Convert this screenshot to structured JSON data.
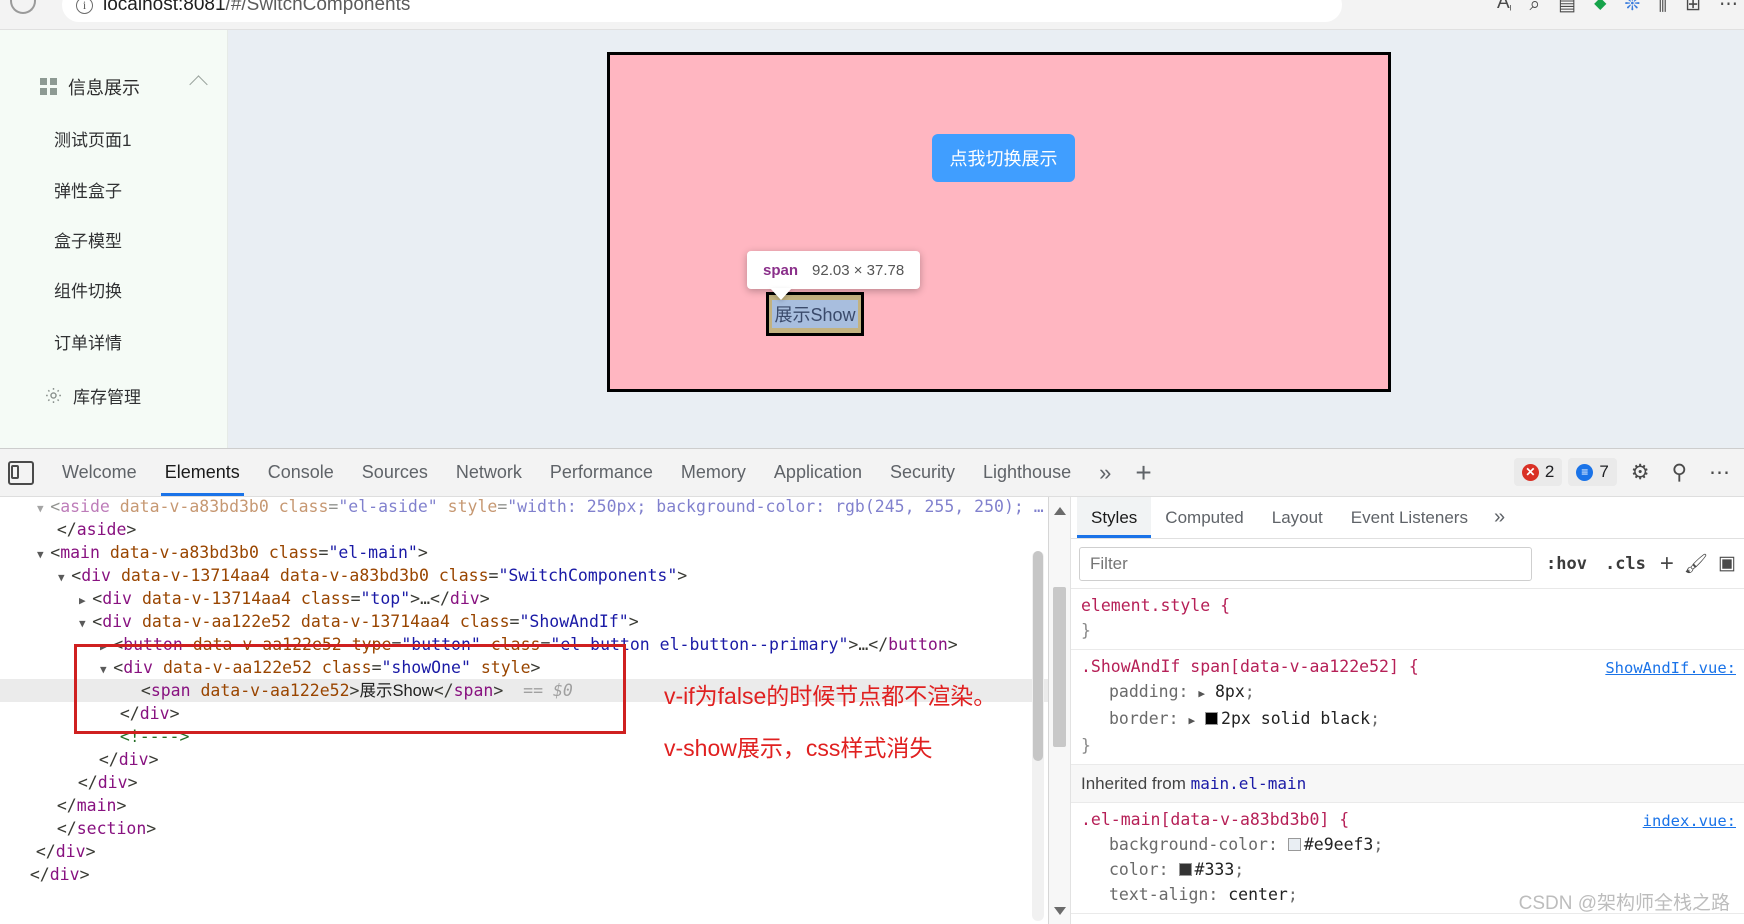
{
  "browser": {
    "url_prefix": "localhost:8081",
    "url_path": "/#/SwitchComponents",
    "reload_icon": "reload-icon",
    "info_icon": "info-circle-icon",
    "right_icons": [
      "read-aloud-icon",
      "zoom-icon",
      "collections-icon",
      "shield-icon",
      "extensions-icon",
      "split-screen-icon",
      "browser-essentials-icon",
      "more-icon"
    ]
  },
  "sidebar": {
    "header": {
      "label": "信息展示",
      "icon": "grid-icon",
      "chevron": "chevron-up-icon"
    },
    "items": [
      {
        "label": "测试页面1",
        "icon": null
      },
      {
        "label": "弹性盒子",
        "icon": null
      },
      {
        "label": "盒子模型",
        "icon": null
      },
      {
        "label": "组件切换",
        "icon": null
      },
      {
        "label": "订单详情",
        "icon": null
      },
      {
        "label": "库存管理",
        "icon": "gear-icon"
      }
    ]
  },
  "page": {
    "toggle_button_label": "点我切换展示",
    "span_text": "展示Show",
    "pink_box_color": "#ffb6c1",
    "button_color": "#409eff",
    "tooltip": {
      "tag": "span",
      "dimensions": "92.03 × 37.78"
    }
  },
  "devtools": {
    "tabs": [
      "Welcome",
      "Elements",
      "Console",
      "Sources",
      "Network",
      "Performance",
      "Memory",
      "Application",
      "Security",
      "Lighthouse"
    ],
    "active_tab": "Elements",
    "more_tabs_icon": "chevron-double-right-icon",
    "add_tab_icon": "plus-icon",
    "error_count": "2",
    "message_count": "7",
    "settings_icon": "gear-icon",
    "devices_icon": "devices-icon",
    "more_icon": "ellipsis-icon",
    "dock_icon": "dock-side-icon"
  },
  "dom_tree": [
    {
      "indent": 1,
      "triangle": "down",
      "selected": false,
      "faded": true,
      "parts": [
        {
          "t": "punct",
          "v": "<"
        },
        {
          "t": "tag",
          "v": "aside"
        },
        {
          "t": "punct",
          "v": " "
        },
        {
          "t": "attr",
          "v": "data-v-a83bd3b0"
        },
        {
          "t": "punct",
          "v": " "
        },
        {
          "t": "attr",
          "v": "class"
        },
        {
          "t": "punct",
          "v": "="
        },
        {
          "t": "val",
          "v": "\"el-aside\""
        },
        {
          "t": "punct",
          "v": " "
        },
        {
          "t": "attr",
          "v": "style"
        },
        {
          "t": "punct",
          "v": "="
        },
        {
          "t": "val",
          "v": "\"width: 250px; background-color: rgb(245, 255, 250); …"
        }
      ]
    },
    {
      "indent": 1,
      "triangle": "none",
      "selected": false,
      "parts": [
        {
          "t": "punct",
          "v": "</"
        },
        {
          "t": "tag",
          "v": "aside"
        },
        {
          "t": "punct",
          "v": ">"
        }
      ]
    },
    {
      "indent": 1,
      "triangle": "down",
      "selected": false,
      "parts": [
        {
          "t": "punct",
          "v": "<"
        },
        {
          "t": "tag",
          "v": "main"
        },
        {
          "t": "punct",
          "v": " "
        },
        {
          "t": "attr",
          "v": "data-v-a83bd3b0"
        },
        {
          "t": "punct",
          "v": " "
        },
        {
          "t": "attr",
          "v": "class"
        },
        {
          "t": "punct",
          "v": "="
        },
        {
          "t": "val",
          "v": "\"el-main\""
        },
        {
          "t": "punct",
          "v": ">"
        }
      ]
    },
    {
      "indent": 2,
      "triangle": "down",
      "selected": false,
      "parts": [
        {
          "t": "punct",
          "v": "<"
        },
        {
          "t": "tag",
          "v": "div"
        },
        {
          "t": "punct",
          "v": " "
        },
        {
          "t": "attr",
          "v": "data-v-13714aa4"
        },
        {
          "t": "punct",
          "v": " "
        },
        {
          "t": "attr",
          "v": "data-v-a83bd3b0"
        },
        {
          "t": "punct",
          "v": " "
        },
        {
          "t": "attr",
          "v": "class"
        },
        {
          "t": "punct",
          "v": "="
        },
        {
          "t": "val",
          "v": "\"SwitchComponents\""
        },
        {
          "t": "punct",
          "v": ">"
        }
      ]
    },
    {
      "indent": 3,
      "triangle": "right",
      "selected": false,
      "parts": [
        {
          "t": "punct",
          "v": "<"
        },
        {
          "t": "tag",
          "v": "div"
        },
        {
          "t": "punct",
          "v": " "
        },
        {
          "t": "attr",
          "v": "data-v-13714aa4"
        },
        {
          "t": "punct",
          "v": " "
        },
        {
          "t": "attr",
          "v": "class"
        },
        {
          "t": "punct",
          "v": "="
        },
        {
          "t": "val",
          "v": "\"top\""
        },
        {
          "t": "punct",
          "v": ">…</"
        },
        {
          "t": "tag",
          "v": "div"
        },
        {
          "t": "punct",
          "v": ">"
        }
      ]
    },
    {
      "indent": 3,
      "triangle": "down",
      "selected": false,
      "parts": [
        {
          "t": "punct",
          "v": "<"
        },
        {
          "t": "tag",
          "v": "div"
        },
        {
          "t": "punct",
          "v": " "
        },
        {
          "t": "attr",
          "v": "data-v-aa122e52"
        },
        {
          "t": "punct",
          "v": " "
        },
        {
          "t": "attr",
          "v": "data-v-13714aa4"
        },
        {
          "t": "punct",
          "v": " "
        },
        {
          "t": "attr",
          "v": "class"
        },
        {
          "t": "punct",
          "v": "="
        },
        {
          "t": "val",
          "v": "\"ShowAndIf\""
        },
        {
          "t": "punct",
          "v": ">"
        }
      ]
    },
    {
      "indent": 4,
      "triangle": "right",
      "selected": false,
      "parts": [
        {
          "t": "punct",
          "v": "<"
        },
        {
          "t": "tag",
          "v": "button"
        },
        {
          "t": "punct",
          "v": " "
        },
        {
          "t": "attr",
          "v": "data-v-aa122e52"
        },
        {
          "t": "punct",
          "v": " "
        },
        {
          "t": "attr",
          "v": "type"
        },
        {
          "t": "punct",
          "v": "="
        },
        {
          "t": "val",
          "v": "\"button\""
        },
        {
          "t": "punct",
          "v": " "
        },
        {
          "t": "attr",
          "v": "class"
        },
        {
          "t": "punct",
          "v": "="
        },
        {
          "t": "val",
          "v": "\"el-button el-button--primary\""
        },
        {
          "t": "punct",
          "v": ">…</"
        },
        {
          "t": "tag",
          "v": "button"
        },
        {
          "t": "punct",
          "v": ">"
        }
      ]
    },
    {
      "indent": 4,
      "triangle": "down",
      "selected": false,
      "parts": [
        {
          "t": "punct",
          "v": "<"
        },
        {
          "t": "tag",
          "v": "div"
        },
        {
          "t": "punct",
          "v": " "
        },
        {
          "t": "attr",
          "v": "data-v-aa122e52"
        },
        {
          "t": "punct",
          "v": " "
        },
        {
          "t": "attr",
          "v": "class"
        },
        {
          "t": "punct",
          "v": "="
        },
        {
          "t": "val",
          "v": "\"showOne\""
        },
        {
          "t": "punct",
          "v": " "
        },
        {
          "t": "attr",
          "v": "style"
        },
        {
          "t": "punct",
          "v": ">"
        }
      ]
    },
    {
      "indent": 5,
      "triangle": "none",
      "selected": true,
      "parts": [
        {
          "t": "punct",
          "v": "<"
        },
        {
          "t": "tag",
          "v": "span"
        },
        {
          "t": "punct",
          "v": " "
        },
        {
          "t": "attr",
          "v": "data-v-aa122e52"
        },
        {
          "t": "punct",
          "v": ">"
        },
        {
          "t": "txt",
          "v": "展示Show"
        },
        {
          "t": "punct",
          "v": "</"
        },
        {
          "t": "tag",
          "v": "span"
        },
        {
          "t": "punct",
          "v": ">"
        },
        {
          "t": "eq",
          "v": "  == "
        },
        {
          "t": "dollar",
          "v": "$0"
        }
      ]
    },
    {
      "indent": 4,
      "triangle": "none",
      "selected": false,
      "parts": [
        {
          "t": "punct",
          "v": "</"
        },
        {
          "t": "tag",
          "v": "div"
        },
        {
          "t": "punct",
          "v": ">"
        }
      ]
    },
    {
      "indent": 4,
      "triangle": "none",
      "selected": false,
      "parts": [
        {
          "t": "comment",
          "v": "<!---->"
        }
      ]
    },
    {
      "indent": 3,
      "triangle": "none",
      "selected": false,
      "parts": [
        {
          "t": "punct",
          "v": "</"
        },
        {
          "t": "tag",
          "v": "div"
        },
        {
          "t": "punct",
          "v": ">"
        }
      ]
    },
    {
      "indent": 2,
      "triangle": "none",
      "selected": false,
      "parts": [
        {
          "t": "punct",
          "v": "</"
        },
        {
          "t": "tag",
          "v": "div"
        },
        {
          "t": "punct",
          "v": ">"
        }
      ]
    },
    {
      "indent": 1,
      "triangle": "none",
      "selected": false,
      "parts": [
        {
          "t": "punct",
          "v": "</"
        },
        {
          "t": "tag",
          "v": "main"
        },
        {
          "t": "punct",
          "v": ">"
        }
      ]
    },
    {
      "indent": 1,
      "triangle": "none",
      "selected": false,
      "parts": [
        {
          "t": "punct",
          "v": "</"
        },
        {
          "t": "tag",
          "v": "section"
        },
        {
          "t": "punct",
          "v": ">"
        }
      ]
    },
    {
      "indent": 0,
      "triangle": "none",
      "selected": false,
      "parts": [
        {
          "t": "punct",
          "v": "</"
        },
        {
          "t": "tag",
          "v": "div"
        },
        {
          "t": "punct",
          "v": ">"
        }
      ]
    },
    {
      "indent": -1,
      "triangle": "none",
      "selected": false,
      "parts": [
        {
          "t": "punct",
          "v": "</"
        },
        {
          "t": "tag",
          "v": "div"
        },
        {
          "t": "punct",
          "v": ">"
        }
      ]
    }
  ],
  "annotations": [
    {
      "text": "v-if为false的时候节点都不渲染。",
      "color": "#e02020"
    },
    {
      "text": "v-show展示，css样式消失",
      "color": "#e02020"
    }
  ],
  "styles_panel": {
    "tabs": [
      "Styles",
      "Computed",
      "Layout",
      "Event Listeners"
    ],
    "active_tab": "Styles",
    "more_icon": "chevron-double-right-icon",
    "filter_placeholder": "Filter",
    "filter_value": "",
    "hov_label": ":hov",
    "cls_label": ".cls",
    "plus_icon": "plus-icon",
    "brush_icon": "brush-icon",
    "box_icon": "computed-box-icon",
    "rules": [
      {
        "selector": "element.style {",
        "source": "",
        "declarations": [],
        "close": "}"
      },
      {
        "selector": ".ShowAndIf span[data-v-aa122e52] {",
        "source": "ShowAndIf.vue:",
        "declarations": [
          {
            "expand": true,
            "prop": "padding",
            "value": "8px",
            "swatch": null
          },
          {
            "expand": true,
            "prop": "border",
            "value": "2px solid black",
            "swatch": "#000000"
          }
        ],
        "close": "}"
      }
    ],
    "inherited_label": "Inherited from",
    "inherited_from": "main.el-main",
    "inherited_rule": {
      "selector": ".el-main[data-v-a83bd3b0] {",
      "source": "index.vue:",
      "declarations": [
        {
          "expand": false,
          "prop": "background-color",
          "value": "#e9eef3",
          "swatch": "#e9eef3"
        },
        {
          "expand": false,
          "prop": "color",
          "value": "#333",
          "swatch": "#333333"
        },
        {
          "expand": false,
          "prop": "text-align",
          "value": "center",
          "swatch": null
        }
      ]
    }
  },
  "watermark": "CSDN @架构师全栈之路"
}
